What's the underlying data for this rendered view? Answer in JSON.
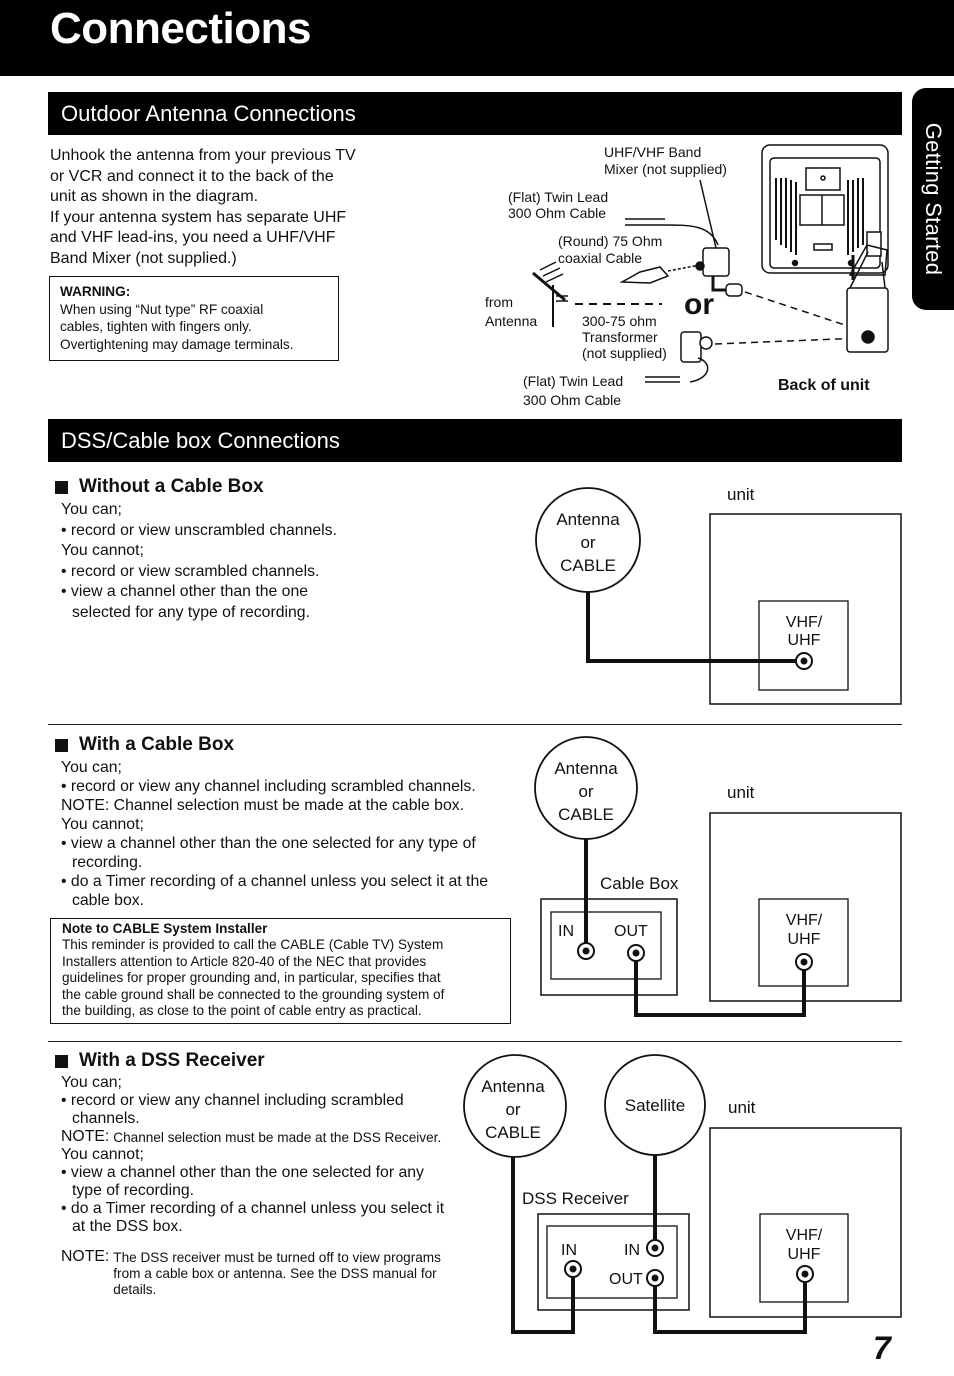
{
  "page": {
    "title": "Connections",
    "side_tab": "Getting Started",
    "page_number": "7"
  },
  "outdoor": {
    "heading": "Outdoor Antenna Connections",
    "paragraph_lines": [
      "Unhook the antenna from your previous TV",
      "or VCR and connect it to the back of the",
      "unit as shown in the diagram.",
      "If your antenna system has separate UHF",
      "and VHF lead-ins, you need a UHF/VHF",
      "Band Mixer (not supplied.)"
    ],
    "warning": {
      "title": "WARNING:",
      "lines": [
        "When using “Nut type” RF coaxial",
        "cables, tighten with fingers only.",
        "Overtightening may damage terminals."
      ]
    },
    "diagram": {
      "mixer_label_1": "UHF/VHF Band",
      "mixer_label_2": "Mixer (not supplied)",
      "twin_lead_top_1": "(Flat) Twin Lead",
      "twin_lead_top_2": "300 Ohm Cable",
      "round_cable_1": "(Round) 75 Ohm",
      "round_cable_2": "coaxial Cable",
      "from_antenna_1": "from",
      "from_antenna_2": "Antenna",
      "or_label": "or",
      "transformer_1": "300-75 ohm",
      "transformer_2": "Transformer",
      "transformer_3": "(not supplied)",
      "twin_lead_bottom_1": "(Flat) Twin Lead",
      "twin_lead_bottom_2": "300 Ohm Cable",
      "back_of_unit": "Back of unit"
    }
  },
  "dss": {
    "heading": "DSS/Cable box Connections",
    "without_box": {
      "heading": "Without a Cable Box",
      "can_label": "You can;",
      "can_items": [
        "• record or view unscrambled channels."
      ],
      "cannot_label": "You cannot;",
      "cannot_items": [
        "• record or view scrambled channels.",
        "• view a channel other than the one selected for any type of recording."
      ],
      "diagram": {
        "source_1": "Antenna",
        "source_2": "or",
        "source_3": "CABLE",
        "unit_label": "unit",
        "port_1": "VHF/",
        "port_2": "UHF"
      }
    },
    "with_box": {
      "heading": "With a Cable Box",
      "can_label": "You can;",
      "can_items": [
        "• record or view any channel including scrambled channels."
      ],
      "note": "NOTE: Channel selection must be made at the cable box.",
      "cannot_label": "You cannot;",
      "cannot_items": [
        "• view a channel other than the one selected for any type of recording.",
        "• do a Timer recording of a channel unless you select it at the cable box."
      ],
      "installer_note": {
        "title": "Note to CABLE System Installer",
        "lines": [
          "This reminder is provided to call the CABLE (Cable TV) System",
          "Installers attention to Article 820-40 of the NEC that provides",
          "guidelines for proper grounding and, in particular, specifies that",
          "the cable ground shall be connected to the grounding system of",
          "the building, as close to the point of cable entry as practical."
        ]
      },
      "diagram": {
        "source_1": "Antenna",
        "source_2": "or",
        "source_3": "CABLE",
        "box_label": "Cable Box",
        "in_label": "IN",
        "out_label": "OUT",
        "unit_label": "unit",
        "port_1": "VHF/",
        "port_2": "UHF"
      }
    },
    "with_dss": {
      "heading": "With a DSS Receiver",
      "can_label": "You can;",
      "can_items": [
        "• record or view any channel including scrambled channels."
      ],
      "note_label": "NOTE:",
      "note_text": "Channel selection must be made at the DSS Receiver.",
      "cannot_label": "You cannot;",
      "cannot_items": [
        "• view a channel other than the one selected for any type of recording.",
        "• do a Timer recording of a channel unless you select it at the DSS box."
      ],
      "note2_label": "NOTE:",
      "note2_text": "The DSS receiver must be turned off to view programs from a cable box or antenna. See the DSS manual for details.",
      "diagram": {
        "source_1": "Antenna",
        "source_2": "or",
        "source_3": "CABLE",
        "satellite": "Satellite",
        "receiver_label": "DSS Receiver",
        "in_label_1": "IN",
        "in_label_2": "IN",
        "out_label": "OUT",
        "unit_label": "unit",
        "port_1": "VHF/",
        "port_2": "UHF"
      }
    }
  }
}
